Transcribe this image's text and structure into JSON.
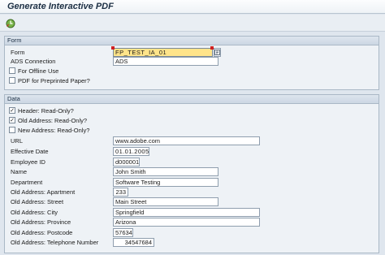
{
  "window": {
    "title": "Generate Interactive PDF"
  },
  "toolbar": {
    "execute_icon": "execute-clock-icon"
  },
  "form_group": {
    "header": "Form",
    "form_label": "Form",
    "form_value": "FP_TEST_IA_01",
    "ads_label": "ADS Connection",
    "ads_value": "ADS",
    "offline_label": "For Offline Use",
    "offline_checked": false,
    "preprinted_label": "PDF for Preprinted Paper?",
    "preprinted_checked": false
  },
  "data_group": {
    "header": "Data",
    "header_readonly_label": "Header: Read-Only?",
    "header_readonly_checked": true,
    "old_address_readonly_label": "Old Address: Read-Only?",
    "old_address_readonly_checked": true,
    "new_address_readonly_label": "New Address: Read-Only?",
    "new_address_readonly_checked": false,
    "fields": {
      "url": {
        "label": "URL",
        "value": "www.adobe.com"
      },
      "effective_date": {
        "label": "Effective Date",
        "value": "01.01.2005"
      },
      "employee_id": {
        "label": "Employee ID",
        "value": "d000001"
      },
      "name": {
        "label": "Name",
        "value": "John Smith"
      },
      "department": {
        "label": "Department",
        "value": "Software Testing"
      },
      "apartment": {
        "label": "Old Address: Apartment",
        "value": "233"
      },
      "street": {
        "label": "Old Address: Street",
        "value": "Main Street"
      },
      "city": {
        "label": "Old Address: City",
        "value": "Springfield"
      },
      "province": {
        "label": "Old Address: Province",
        "value": "Arizona"
      },
      "postcode": {
        "label": "Old Address: Postcode",
        "value": "57634"
      },
      "telephone": {
        "label": "Old Address: Telephone Number",
        "value": "34547684"
      }
    }
  }
}
